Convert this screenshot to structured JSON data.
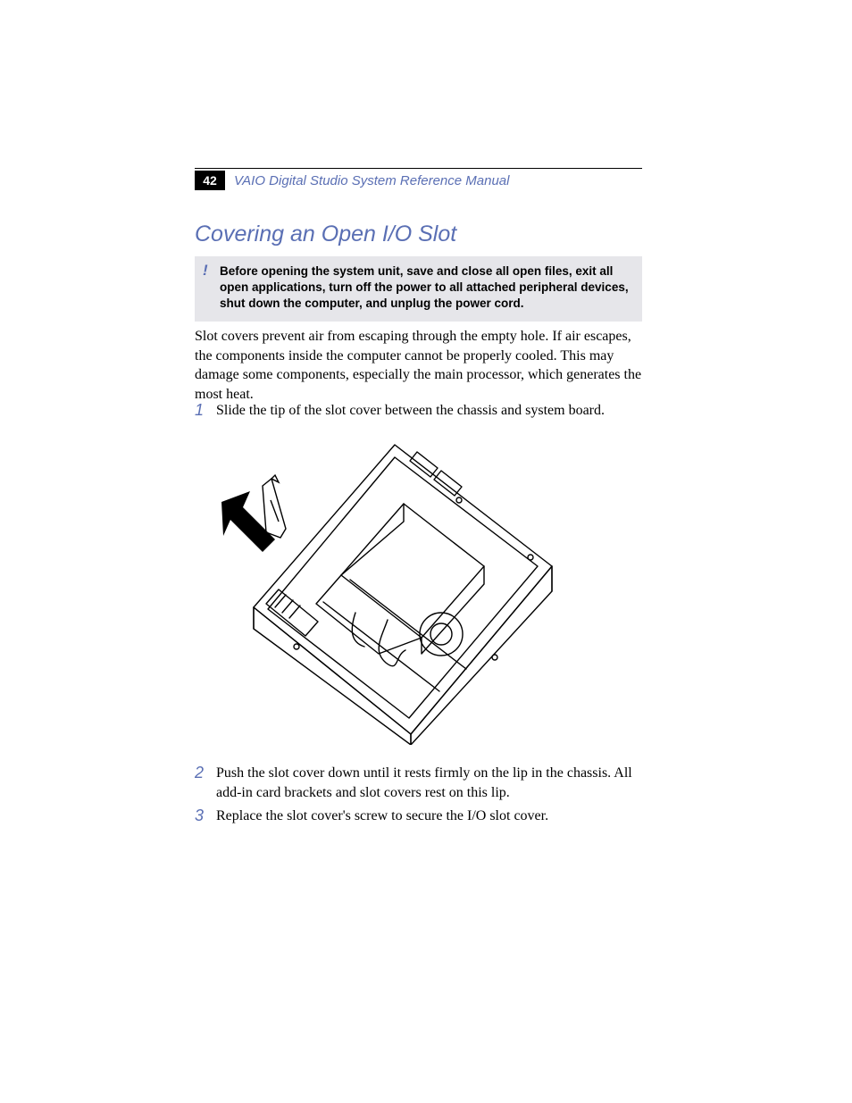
{
  "page_number": "42",
  "running_head": "VAIO Digital Studio System Reference Manual",
  "section_title": "Covering an Open I/O Slot",
  "warning": {
    "mark": "!",
    "text": "Before opening the system unit, save and close all open files, exit all open applications, turn off the power to all attached peripheral devices, shut down the computer, and unplug the power cord."
  },
  "paragraph1": "Slot covers prevent air from escaping through the empty hole. If air escapes, the components inside the computer cannot be properly cooled. This may damage some components, especially the main processor, which generates the most heat.",
  "steps": [
    {
      "num": "1",
      "text": "Slide the tip of the slot cover between the chassis and system board."
    },
    {
      "num": "2",
      "text": "Push the slot cover down until it rests firmly on the lip in the chassis. All add-in card brackets and slot covers rest on this lip."
    },
    {
      "num": "3",
      "text": "Replace the slot cover's screw to secure the I/O slot cover."
    }
  ],
  "figure_alt": "Line drawing of an open computer chassis viewed from above at an angle, with an arrow and a slot-cover screw indicating insertion of the slot cover at the rear I/O area.",
  "colors": {
    "accent": "#5a6fb4",
    "warn_bg": "#e6e6ea"
  }
}
